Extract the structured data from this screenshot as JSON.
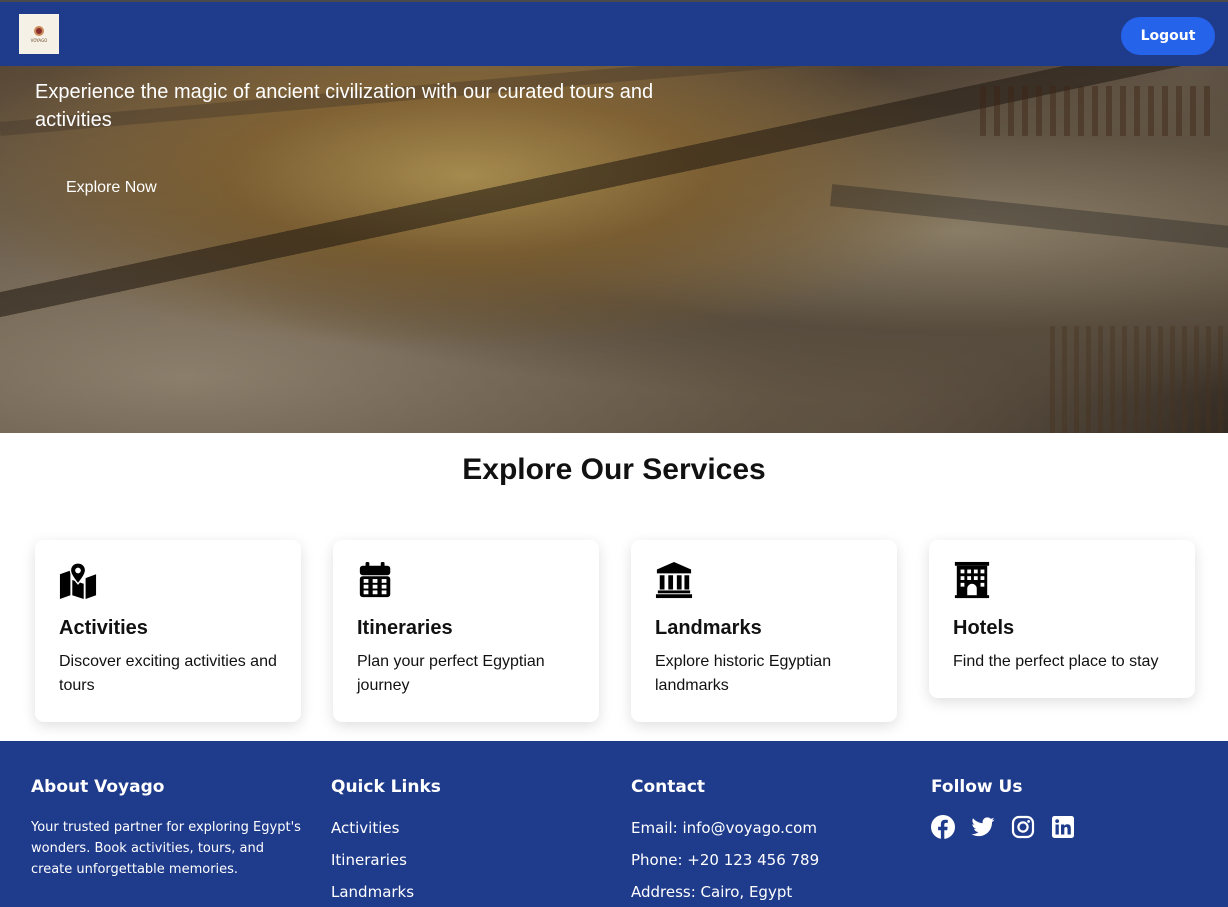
{
  "header": {
    "logo_text": "VOYAGO",
    "logout_label": "Logout"
  },
  "hero": {
    "tagline": "Experience the magic of ancient civilization with our curated tours and activities",
    "cta_label": "Explore Now"
  },
  "services": {
    "title": "Explore Our Services",
    "cards": [
      {
        "icon": "map-location-icon",
        "title": "Activities",
        "description": "Discover exciting activities and tours"
      },
      {
        "icon": "calendar-icon",
        "title": "Itineraries",
        "description": "Plan your perfect Egyptian journey"
      },
      {
        "icon": "landmark-icon",
        "title": "Landmarks",
        "description": "Explore historic Egyptian landmarks"
      },
      {
        "icon": "hotel-icon",
        "title": "Hotels",
        "description": "Find the perfect place to stay"
      }
    ]
  },
  "footer": {
    "about": {
      "heading": "About Voyago",
      "text": "Your trusted partner for exploring Egypt's wonders. Book activities, tours, and create unforgettable memories."
    },
    "quick_links": {
      "heading": "Quick Links",
      "items": [
        "Activities",
        "Itineraries",
        "Landmarks"
      ]
    },
    "contact": {
      "heading": "Contact",
      "email": "Email: info@voyago.com",
      "phone": "Phone: +20 123 456 789",
      "address": "Address: Cairo, Egypt"
    },
    "follow": {
      "heading": "Follow Us",
      "icons": [
        "facebook-icon",
        "twitter-icon",
        "instagram-icon",
        "linkedin-icon"
      ]
    }
  },
  "colors": {
    "brand_blue": "#1f3b8c",
    "button_blue": "#2563eb"
  }
}
